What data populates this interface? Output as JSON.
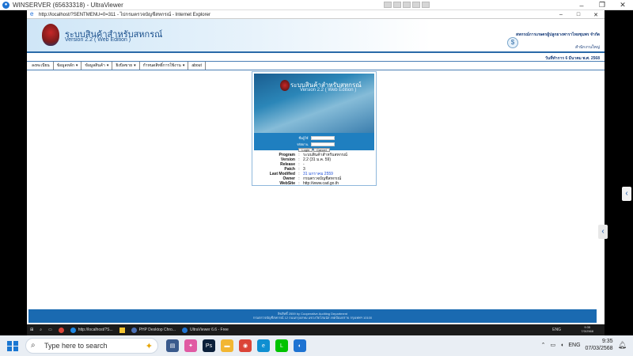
{
  "uv": {
    "title": "WINSERVER (65633318) - UltraViewer",
    "controls": {
      "minimize": "–",
      "restore": "❐",
      "close": "✕"
    }
  },
  "ie": {
    "title": "http://localhost/?SENTMENU=0=311 - ไปกรมตรวจบัญชีสหกรณ์ - Internet Explorer",
    "controls": {
      "minimize": "–",
      "maximize": "□",
      "close": "✕"
    }
  },
  "banner": {
    "system_title": "ระบบสินค้าสำหรับสหกรณ์",
    "system_version": "Version 2.2 ( Web Edition )",
    "org_name": "สหกรณ์การเกษตรผู้ปลูกยางพาราไทยชุมพร จำกัด",
    "branch": "สำนักงานใหญ่",
    "date": "วันที่ทำการ 6 มีนาคม พ.ศ. 2568"
  },
  "menu": [
    {
      "label": "ลงทะเบียน",
      "has_submenu": false
    },
    {
      "label": "ข้อมูลหลัก",
      "has_submenu": true
    },
    {
      "label": "ข้อมูลสินค้า",
      "has_submenu": true
    },
    {
      "label": "ยิงบิลขาย",
      "has_submenu": true
    },
    {
      "label": "กำหนดสิทธิ์การใช้งาน",
      "has_submenu": true
    },
    {
      "label": "about",
      "has_submenu": false
    }
  ],
  "login": {
    "hero_title": "ระบบสินค้าสำหรับสหกรณ์",
    "hero_version": "Version 2.2 ( Web Edition )",
    "username_label": "ชื่อผู้ใช้",
    "password_label": "รหัสผ่าน",
    "username_value": "",
    "password_value": "",
    "login_button": "Login",
    "cancel_button": "Cancel"
  },
  "info": [
    {
      "key": "Program",
      "value": "ระบบสินค้าสำหรับสหกรณ์"
    },
    {
      "key": "Version",
      "value": "2.2 (31 ม.ค. 59)"
    },
    {
      "key": "Release",
      "value": "-"
    },
    {
      "key": "Patch",
      "value": "3"
    },
    {
      "key": "Last Modified",
      "value": "31 มกราคม 2559"
    },
    {
      "key": "Owner",
      "value": "กรมตรวจบัญชีสหกรณ์"
    },
    {
      "key": "WebSite",
      "value": "http://www.cad.go.th"
    }
  ],
  "footer": {
    "line1": "ลิขสิทธิ์ 2559 by Cooperative Auditing Department",
    "line2": "กรมตรวจบัญชีสหกรณ์ 12 ถนนกรุงเกษม แขวงวัดโสมนัส เขตป้อมปราบ กรุงเทพฯ 10100"
  },
  "remote_taskbar": {
    "items": [
      {
        "label": "http://localhost/?S...",
        "icon": "ie-icon",
        "color": "#1e88e5"
      },
      {
        "label": "",
        "icon": "folder-icon",
        "color": "#f4c430"
      },
      {
        "label": "PHP Desktop Chro...",
        "icon": "php-icon",
        "color": "#4a6fb5"
      },
      {
        "label": "UltraViewer 6.6 - Free",
        "icon": "uv-icon",
        "color": "#1e73d2"
      }
    ],
    "lang": "ENG",
    "time": "9:35",
    "date": "7/3/2568"
  },
  "taskbar": {
    "search_placeholder": "Type here to search",
    "apps": [
      {
        "name": "files-app-icon",
        "color": "#3a5a8c",
        "glyph": "▤"
      },
      {
        "name": "colorful-app-icon",
        "color": "#e05aa3",
        "glyph": "✦"
      },
      {
        "name": "photoshop-icon",
        "color": "#0b1f3a",
        "glyph": "Ps"
      },
      {
        "name": "file-explorer-icon",
        "color": "#f2b632",
        "glyph": "▬"
      },
      {
        "name": "chrome-icon",
        "color": "#db4437",
        "glyph": "◉"
      },
      {
        "name": "edge-icon",
        "color": "#0f8fd1",
        "glyph": "e"
      },
      {
        "name": "line-icon",
        "color": "#00c300",
        "glyph": "L"
      },
      {
        "name": "ultraviewer-icon",
        "color": "#1e73d2",
        "glyph": "◐"
      }
    ],
    "lang": "ENG",
    "time": "9:35",
    "date": "07/03/2568"
  }
}
